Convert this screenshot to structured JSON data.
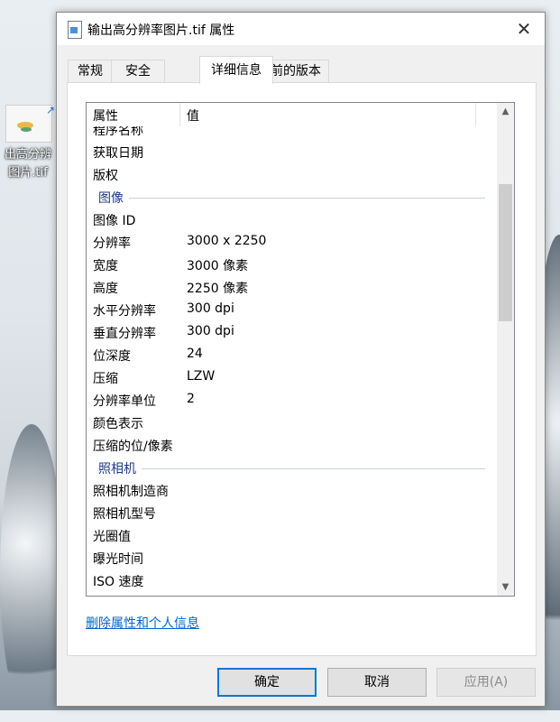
{
  "desktop": {
    "icon_label_line1": "出高分辨",
    "icon_label_line2": "图片.tif"
  },
  "dialog": {
    "title": "输出高分辨率图片.tif 属性",
    "close_glyph": "✕",
    "tabs": [
      "常规",
      "安全",
      "详细信息",
      "以前的版本"
    ],
    "active_tab": "详细信息",
    "list_header": {
      "property": "属性",
      "value": "值"
    },
    "partial_row": "程序名称",
    "rows": [
      {
        "type": "item",
        "key": "获取日期",
        "value": ""
      },
      {
        "type": "item",
        "key": "版权",
        "value": ""
      },
      {
        "type": "section",
        "key": "图像"
      },
      {
        "type": "item",
        "key": "图像 ID",
        "value": ""
      },
      {
        "type": "item",
        "key": "分辨率",
        "value": "3000 x 2250"
      },
      {
        "type": "item",
        "key": "宽度",
        "value": "3000 像素"
      },
      {
        "type": "item",
        "key": "高度",
        "value": "2250 像素"
      },
      {
        "type": "item",
        "key": "水平分辨率",
        "value": "300 dpi"
      },
      {
        "type": "item",
        "key": "垂直分辨率",
        "value": "300 dpi"
      },
      {
        "type": "item",
        "key": "位深度",
        "value": "24"
      },
      {
        "type": "item",
        "key": "压缩",
        "value": "LZW"
      },
      {
        "type": "item",
        "key": "分辨率单位",
        "value": "2"
      },
      {
        "type": "item",
        "key": "颜色表示",
        "value": ""
      },
      {
        "type": "item",
        "key": "压缩的位/像素",
        "value": ""
      },
      {
        "type": "section",
        "key": "照相机"
      },
      {
        "type": "item",
        "key": "照相机制造商",
        "value": ""
      },
      {
        "type": "item",
        "key": "照相机型号",
        "value": ""
      },
      {
        "type": "item",
        "key": "光圈值",
        "value": ""
      },
      {
        "type": "item",
        "key": "曝光时间",
        "value": ""
      },
      {
        "type": "item",
        "key": "ISO 速度",
        "value": ""
      }
    ],
    "remove_link": "删除属性和个人信息",
    "buttons": {
      "ok": "确定",
      "cancel": "取消",
      "apply": "应用(A)"
    },
    "scroll_up_glyph": "▲",
    "scroll_down_glyph": "▼"
  }
}
